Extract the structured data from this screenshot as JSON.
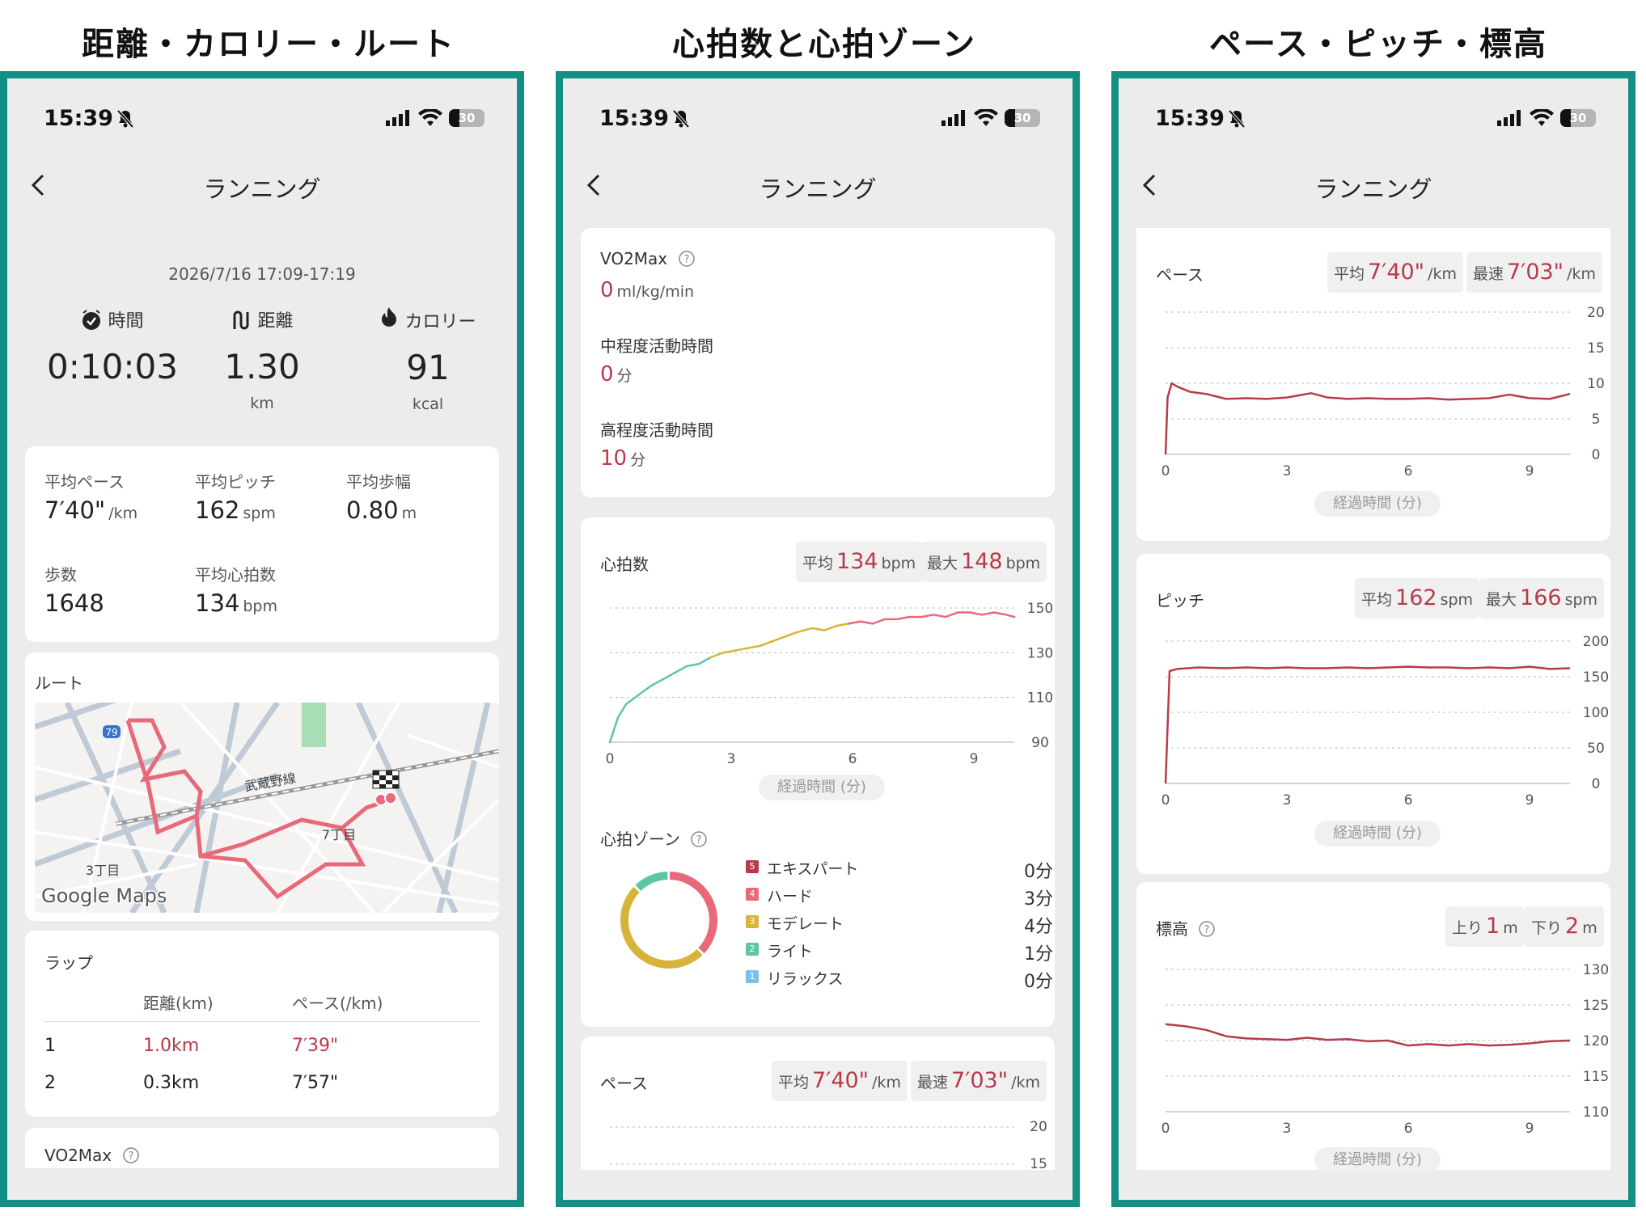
{
  "captions": [
    "距離・カロリー・ルート",
    "心拍数と心拍ゾーン",
    "ペース・ピッチ・標高"
  ],
  "status": {
    "time": "15:39",
    "battery": "30"
  },
  "nav": {
    "title": "ランニング"
  },
  "summary": {
    "datetime": "2026/7/16 17:09-17:19",
    "time_label": "時間",
    "time_value": "0:10:03",
    "distance_label": "距離",
    "distance_value": "1.30",
    "distance_unit": "km",
    "calorie_label": "カロリー",
    "calorie_value": "91",
    "calorie_unit": "kcal"
  },
  "stats": {
    "avg_pace_label": "平均ペース",
    "avg_pace": "7′40\"",
    "avg_pace_unit": "/km",
    "avg_pitch_label": "平均ピッチ",
    "avg_pitch": "162",
    "avg_pitch_unit": "spm",
    "avg_stride_label": "平均歩幅",
    "avg_stride": "0.80",
    "avg_stride_unit": "m",
    "steps_label": "歩数",
    "steps": "1648",
    "avg_hr_label": "平均心拍数",
    "avg_hr": "134",
    "avg_hr_unit": "bpm"
  },
  "route": {
    "title": "ルート",
    "map_labels": {
      "road": "武蔵野線",
      "block1": "7丁目",
      "block2": "3丁目",
      "route_no": "79"
    },
    "map_logo": "Google Maps"
  },
  "laps": {
    "title": "ラップ",
    "headers": [
      "距離(km)",
      "ペース(/km)"
    ],
    "rows": [
      {
        "no": "1",
        "dist": "1.0km",
        "pace": "7′39\""
      },
      {
        "no": "2",
        "dist": "0.3km",
        "pace": "7′57\""
      }
    ]
  },
  "vo2": {
    "title": "VO2Max",
    "value": "0",
    "unit": "ml/kg/min",
    "moderate_label": "中程度活動時間",
    "moderate_value": "0",
    "moderate_unit": "分",
    "vigorous_label": "高程度活動時間",
    "vigorous_value": "10",
    "vigorous_unit": "分"
  },
  "heart": {
    "title": "心拍数",
    "avg_label": "平均",
    "avg": "134",
    "max_label": "最大",
    "max": "148",
    "unit": "bpm",
    "axis_title": "経過時間 (分)"
  },
  "zones": {
    "title": "心拍ゾーン",
    "items": [
      {
        "no": "5",
        "name": "エキスパート",
        "minutes": "0分",
        "color": "#b83a4b"
      },
      {
        "no": "4",
        "name": "ハード",
        "minutes": "3分",
        "color": "#e8697a"
      },
      {
        "no": "3",
        "name": "モデレート",
        "minutes": "4分",
        "color": "#d6b43a"
      },
      {
        "no": "2",
        "name": "ライト",
        "minutes": "1分",
        "color": "#5cc7a2"
      },
      {
        "no": "1",
        "name": "リラックス",
        "minutes": "0分",
        "color": "#7cc0e8"
      }
    ]
  },
  "pace": {
    "title": "ペース",
    "avg_label": "平均",
    "avg": "7′40\"",
    "best_label": "最速",
    "best": "7′03\"",
    "unit": "/km",
    "axis_title": "経過時間 (分)"
  },
  "pitch": {
    "title": "ピッチ",
    "avg_label": "平均",
    "avg": "162",
    "max_label": "最大",
    "max": "166",
    "unit": "spm",
    "axis_title": "経過時間 (分)"
  },
  "elev": {
    "title": "標高",
    "up_label": "上り",
    "up": "1",
    "down_label": "下り",
    "down": "2",
    "unit": "m",
    "axis_title": "経過時間 (分)"
  },
  "chart_data": [
    {
      "type": "line",
      "name": "heart_rate",
      "x_ticks": [
        0,
        3,
        6,
        9
      ],
      "y_ticks": [
        90,
        110,
        130,
        150
      ],
      "xlim": [
        0,
        10
      ],
      "ylim": [
        90,
        150
      ],
      "x": [
        0,
        0.2,
        0.4,
        0.7,
        1.0,
        1.3,
        1.6,
        1.9,
        2.2,
        2.5,
        2.8,
        3.1,
        3.4,
        3.7,
        4.0,
        4.3,
        4.6,
        5.0,
        5.3,
        5.6,
        5.9,
        6.2,
        6.5,
        6.8,
        7.1,
        7.4,
        7.7,
        8.0,
        8.3,
        8.6,
        8.9,
        9.2,
        9.5,
        9.8,
        10.0
      ],
      "values": [
        90,
        101,
        107,
        111,
        115,
        118,
        121,
        124,
        125,
        128,
        130,
        131,
        132,
        133,
        135,
        137,
        139,
        141,
        140,
        142,
        143,
        144,
        143,
        145,
        145,
        146,
        146,
        147,
        146,
        148,
        148,
        147,
        148,
        147,
        146
      ]
    },
    {
      "type": "line",
      "name": "pace",
      "x_ticks": [
        0,
        3,
        6,
        9
      ],
      "y_ticks": [
        0,
        5,
        10,
        15,
        20
      ],
      "xlim": [
        0,
        10
      ],
      "ylim": [
        0,
        20
      ],
      "x": [
        0,
        0.05,
        0.15,
        0.3,
        0.6,
        1.0,
        1.5,
        2.0,
        2.5,
        3.0,
        3.3,
        3.6,
        4.0,
        4.5,
        5.0,
        5.5,
        6.0,
        6.5,
        7.0,
        7.5,
        8.0,
        8.5,
        9.0,
        9.5,
        10.0
      ],
      "values": [
        0,
        8,
        10,
        9.5,
        8.8,
        8.5,
        7.8,
        7.9,
        7.8,
        8.0,
        8.3,
        8.6,
        8.0,
        7.8,
        7.9,
        7.8,
        7.8,
        7.9,
        7.7,
        7.8,
        7.9,
        8.4,
        7.9,
        7.8,
        8.5
      ]
    },
    {
      "type": "line",
      "name": "pitch",
      "x_ticks": [
        0,
        3,
        6,
        9
      ],
      "y_ticks": [
        0,
        50,
        100,
        150,
        200
      ],
      "xlim": [
        0,
        10
      ],
      "ylim": [
        0,
        200
      ],
      "x": [
        0,
        0.1,
        0.3,
        0.8,
        1.5,
        2.0,
        2.5,
        3.0,
        3.5,
        4.0,
        4.5,
        5.0,
        5.5,
        6.0,
        6.5,
        7.0,
        7.5,
        8.0,
        8.5,
        9.0,
        9.5,
        10.0
      ],
      "values": [
        0,
        158,
        161,
        163,
        162,
        163,
        162,
        163,
        162,
        162,
        163,
        162,
        163,
        164,
        163,
        163,
        162,
        163,
        162,
        164,
        161,
        162
      ]
    },
    {
      "type": "line",
      "name": "elevation",
      "x_ticks": [
        0,
        3,
        6,
        9
      ],
      "y_ticks": [
        110,
        115,
        120,
        125,
        130
      ],
      "xlim": [
        0,
        10
      ],
      "ylim": [
        110,
        130
      ],
      "x": [
        0,
        0.5,
        1.0,
        1.5,
        2.0,
        2.5,
        3.0,
        3.5,
        4.0,
        4.5,
        5.0,
        5.5,
        6.0,
        6.5,
        7.0,
        7.5,
        8.0,
        8.5,
        9.0,
        9.5,
        10.0
      ],
      "values": [
        122.3,
        122,
        121.5,
        120.6,
        120.3,
        120.2,
        120.1,
        120.4,
        120.1,
        120.2,
        119.9,
        120,
        119.3,
        119.5,
        119.3,
        119.5,
        119.3,
        119.4,
        119.6,
        119.9,
        120
      ]
    }
  ]
}
